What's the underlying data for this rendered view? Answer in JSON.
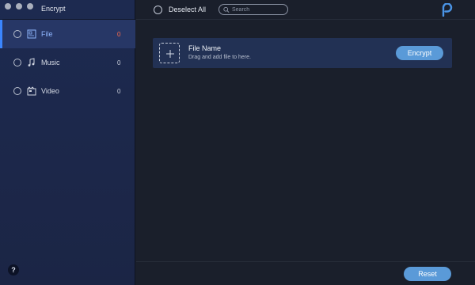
{
  "app": {
    "title": "Encrypt"
  },
  "sidebar": {
    "items": [
      {
        "label": "File",
        "count": "0",
        "icon": "file-icon",
        "active": true
      },
      {
        "label": "Music",
        "count": "0",
        "icon": "music-icon",
        "active": false
      },
      {
        "label": "Video",
        "count": "0",
        "icon": "video-icon",
        "active": false
      }
    ],
    "help_label": "?"
  },
  "toolbar": {
    "deselect_label": "Deselect All",
    "search_placeholder": "Search"
  },
  "file_card": {
    "title": "File Name",
    "hint": "Drag and add file to here.",
    "encrypt_label": "Encrypt"
  },
  "footer": {
    "reset_label": "Reset"
  },
  "colors": {
    "accent": "#5a9ad8",
    "active_bar": "#3b86ff",
    "count_active": "#ff6b4a",
    "sidebar_bg": "#1d2a50",
    "main_bg": "#1a1f2b"
  }
}
